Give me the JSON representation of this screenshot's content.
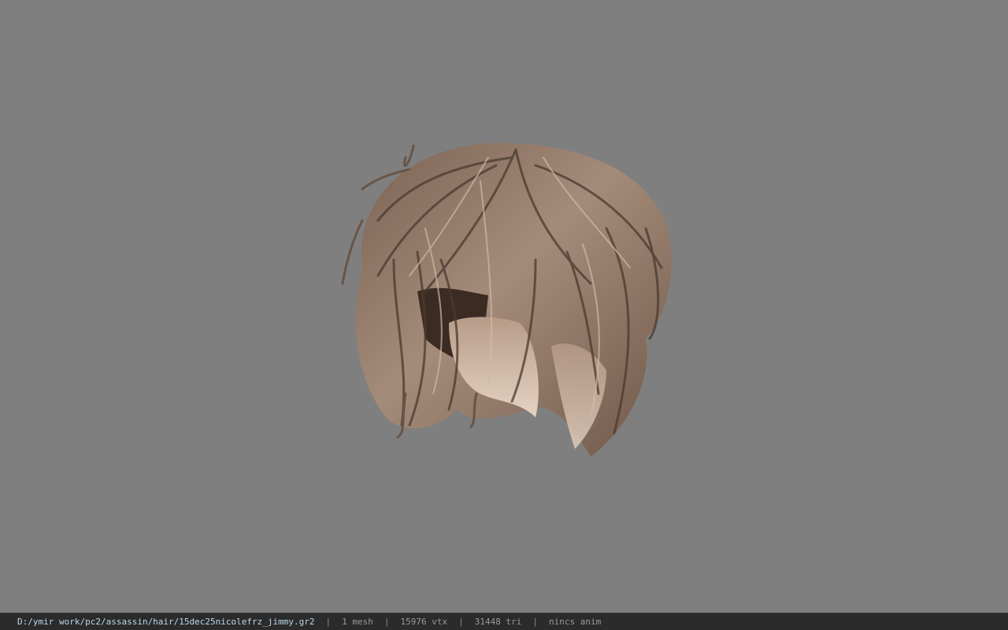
{
  "viewport": {
    "background": "#7f7f7f",
    "model_name": "hair mesh"
  },
  "status_bar": {
    "file_path": "D:/ymir work/pc2/assassin/hair/15dec25nicolefrz_jimmy.gr2",
    "separator": "|",
    "mesh_count": "1 mesh",
    "vertex_count": "15976 vtx",
    "triangle_count": "31448 tri",
    "anim_status": "nincs anim"
  },
  "colors": {
    "hair_dark": "#4a3a2f",
    "hair_mid": "#8a7060",
    "hair_light": "#cbb3a0",
    "status_bg": "#2b2b2b",
    "status_path": "#b9d9ee"
  }
}
